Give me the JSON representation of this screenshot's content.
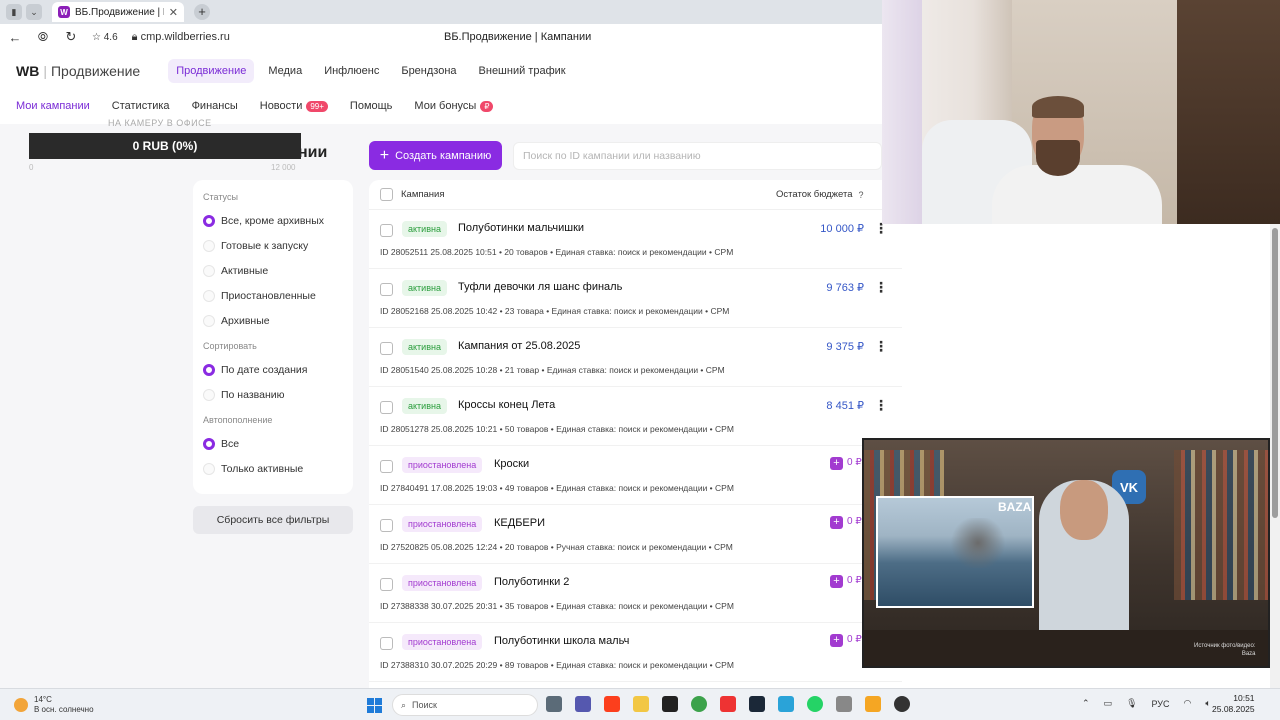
{
  "browser": {
    "tab_title": "ВБ.Продвижение | Кам",
    "favicon": "W",
    "rating": "4.6",
    "url": "cmp.wildberries.ru",
    "page_title": "ВБ.Продвижение | Кампании"
  },
  "app": {
    "logo_wb": "WB",
    "logo_name": "Продвижение",
    "topnav": [
      "Продвижение",
      "Медиа",
      "Инфлюенс",
      "Брендзона",
      "Внешний трафик"
    ],
    "subnav": [
      {
        "label": "Мои кампании",
        "badge": ""
      },
      {
        "label": "Статистика",
        "badge": ""
      },
      {
        "label": "Финансы",
        "badge": ""
      },
      {
        "label": "Новости",
        "badge": "99+"
      },
      {
        "label": "Помощь",
        "badge": ""
      },
      {
        "label": "Мои бонусы",
        "badge": "₽"
      }
    ]
  },
  "overlay": {
    "label": "НА КАМЕРУ В ОФИСЕ",
    "value": "0 RUB (0%)",
    "min": "0",
    "max": "12 000",
    "heading_fragment": "нии"
  },
  "toolbar": {
    "create_label": "Создать кампанию",
    "search_placeholder": "Поиск по ID кампании или названию"
  },
  "filters": {
    "statuses_title": "Статусы",
    "statuses": [
      "Все, кроме архивных",
      "Готовые к запуску",
      "Активные",
      "Приостановленные",
      "Архивные"
    ],
    "sort_title": "Сортировать",
    "sort": [
      "По дате создания",
      "По названию"
    ],
    "autofill_title": "Автопополнение",
    "autofill": [
      "Все",
      "Только активные"
    ],
    "reset_label": "Сбросить все фильтры"
  },
  "table": {
    "col_campaign": "Кампания",
    "col_budget": "Остаток бюджета",
    "rows": [
      {
        "status": "активна",
        "kind": "active",
        "name": "Полуботинки мальчишки",
        "meta": "ID 28052511   25.08.2025 10:51  •  20 товаров  •  Единая ставка: поиск и рекомендации  •  CPM",
        "budget": "10 000 ₽"
      },
      {
        "status": "активна",
        "kind": "active",
        "name": "Туфли девочки ля шанс финаль",
        "meta": "ID 28052168   25.08.2025 10:42  •  23 товара  •  Единая ставка: поиск и рекомендации  •  CPM",
        "budget": "9 763 ₽"
      },
      {
        "status": "активна",
        "kind": "active",
        "name": "Кампания от 25.08.2025",
        "meta": "ID 28051540   25.08.2025 10:28  •  21 товар  •  Единая ставка: поиск и рекомендации  •  CPM",
        "budget": "9 375 ₽"
      },
      {
        "status": "активна",
        "kind": "active",
        "name": "Кроссы конец Лета",
        "meta": "ID 28051278   25.08.2025 10:21  •  50 товаров  •  Единая ставка: поиск и рекомендации  •  CPM",
        "budget": "8 451 ₽"
      },
      {
        "status": "приостановлена",
        "kind": "paused",
        "name": "Кроски",
        "meta": "ID 27840491   17.08.2025 19:03  •  49 товаров  •  Единая ставка: поиск и рекомендации  •  CPM",
        "budget": "0 ₽"
      },
      {
        "status": "приостановлена",
        "kind": "paused",
        "name": "КЕДБЕРИ",
        "meta": "ID 27520825   05.08.2025 12:24  •  20 товаров  •  Ручная ставка: поиск и рекомендации  •  CPM",
        "budget": "0 ₽"
      },
      {
        "status": "приостановлена",
        "kind": "paused",
        "name": "Полуботинки 2",
        "meta": "ID 27388338   30.07.2025 20:31  •  35 товаров  •  Единая ставка: поиск и рекомендации  •  CPM",
        "budget": "0 ₽"
      },
      {
        "status": "приостановлена",
        "kind": "paused",
        "name": "Полуботинки школа мальч",
        "meta": "ID 27388310   30.07.2025 20:29  •  89 товаров  •  Единая ставка: поиск и рекомендации  •  CPM",
        "budget": "0 ₽"
      }
    ]
  },
  "video": {
    "baza": "BAZA",
    "vk": "VK",
    "credit_line1": "Источник фото/видео:",
    "credit_line2": "Baza"
  },
  "taskbar": {
    "temp": "14°C",
    "weather": "В осн. солнечно",
    "search": "Поиск",
    "lang": "РУС",
    "time": "10:51",
    "date": "25.08.2025"
  },
  "colors": {
    "accent": "#8a2be2",
    "active": "#2a9d3c",
    "paused": "#a23bd0",
    "budget": "#3557c7"
  }
}
